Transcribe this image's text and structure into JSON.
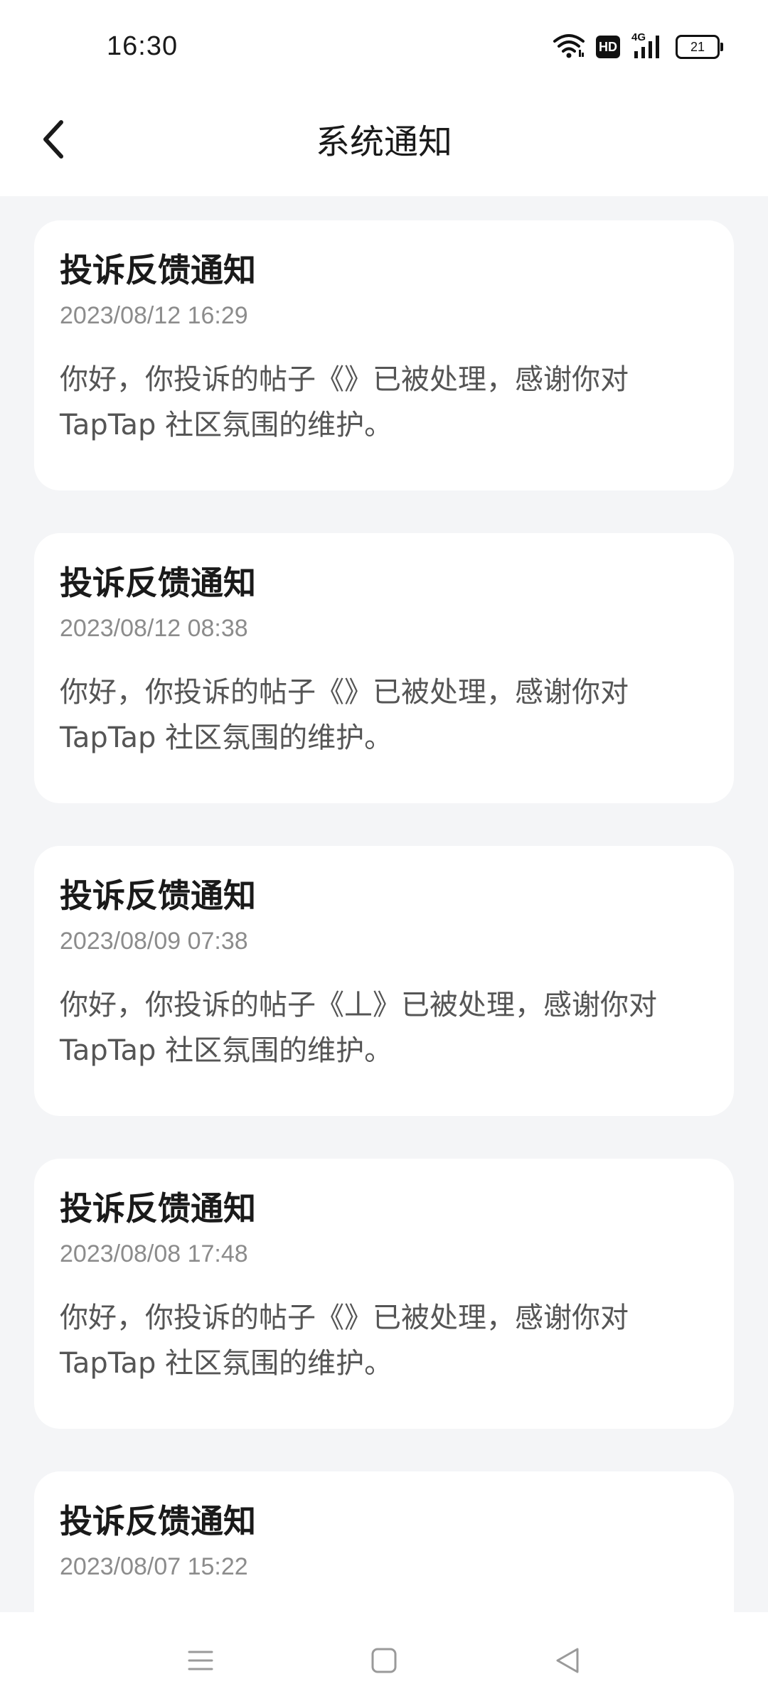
{
  "status_bar": {
    "time": "16:30",
    "hd_badge": "HD",
    "network": "4G",
    "battery": "21"
  },
  "header": {
    "title": "系统通知"
  },
  "notifications": [
    {
      "title": "投诉反馈通知",
      "time": "2023/08/12 16:29",
      "body": "你好，你投诉的帖子《》已被处理，感谢你对TapTap 社区氛围的维护。"
    },
    {
      "title": "投诉反馈通知",
      "time": "2023/08/12 08:38",
      "body": "你好，你投诉的帖子《》已被处理，感谢你对TapTap 社区氛围的维护。"
    },
    {
      "title": "投诉反馈通知",
      "time": "2023/08/09 07:38",
      "body": "你好，你投诉的帖子《丄》已被处理，感谢你对TapTap 社区氛围的维护。"
    },
    {
      "title": "投诉反馈通知",
      "time": "2023/08/08 17:48",
      "body": "你好，你投诉的帖子《》已被处理，感谢你对TapTap 社区氛围的维护。"
    },
    {
      "title": "投诉反馈通知",
      "time": "2023/08/07 15:22",
      "body": ""
    }
  ],
  "icons": {
    "back": "chevron-left-icon",
    "wifi": "wifi-icon",
    "signal": "signal-icon",
    "battery": "battery-icon",
    "nav_menu": "menu-icon",
    "nav_home": "home-square-icon",
    "nav_back": "back-triangle-icon"
  },
  "colors": {
    "page_background": "#f4f5f7",
    "card_background": "#ffffff",
    "title_text": "#1a1a1a",
    "time_text": "#8c8c8c",
    "body_text": "#555555"
  }
}
